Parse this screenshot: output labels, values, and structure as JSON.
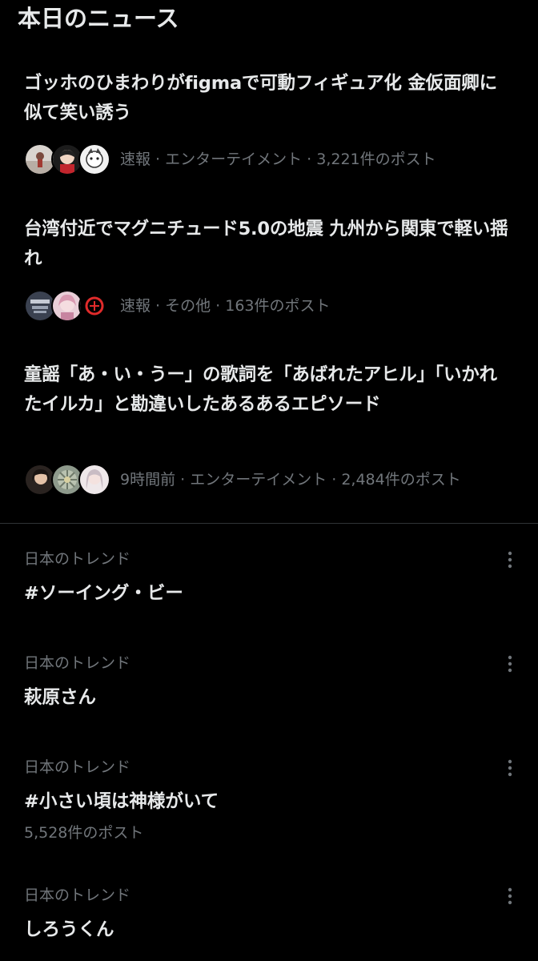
{
  "section": {
    "title": "本日のニュース"
  },
  "news": [
    {
      "headline": "ゴッホのひまわりがfigmaで可動フィギュア化 金仮面卿に似て笑い誘う",
      "meta": "速報 · エンターテイメント · 3,221件のポスト"
    },
    {
      "headline": "台湾付近でマグニチュード5.0の地震 九州から関東で軽い揺れ",
      "meta": "速報 · その他 · 163件のポスト"
    },
    {
      "headline": "童謡「あ・い・うー」の歌詞を「あばれたアヒル」「いかれたイルカ」と勘違いしたあるあるエピソード",
      "meta": "9時間前 · エンターテイメント · 2,484件のポスト"
    }
  ],
  "trends": [
    {
      "context": "日本のトレンド",
      "name": "#ソーイング・ビー",
      "count": ""
    },
    {
      "context": "日本のトレンド",
      "name": "萩原さん",
      "count": ""
    },
    {
      "context": "日本のトレンド",
      "name": "#小さい頃は神様がいて",
      "count": "5,528件のポスト"
    },
    {
      "context": "日本のトレンド",
      "name": "しろうくん",
      "count": ""
    }
  ],
  "colors": {
    "background": "#000000",
    "primary_text": "#e7e9ea",
    "secondary_text": "#71767b",
    "divider": "#2f3336"
  },
  "icons": {
    "more": "more-vertical-icon"
  }
}
